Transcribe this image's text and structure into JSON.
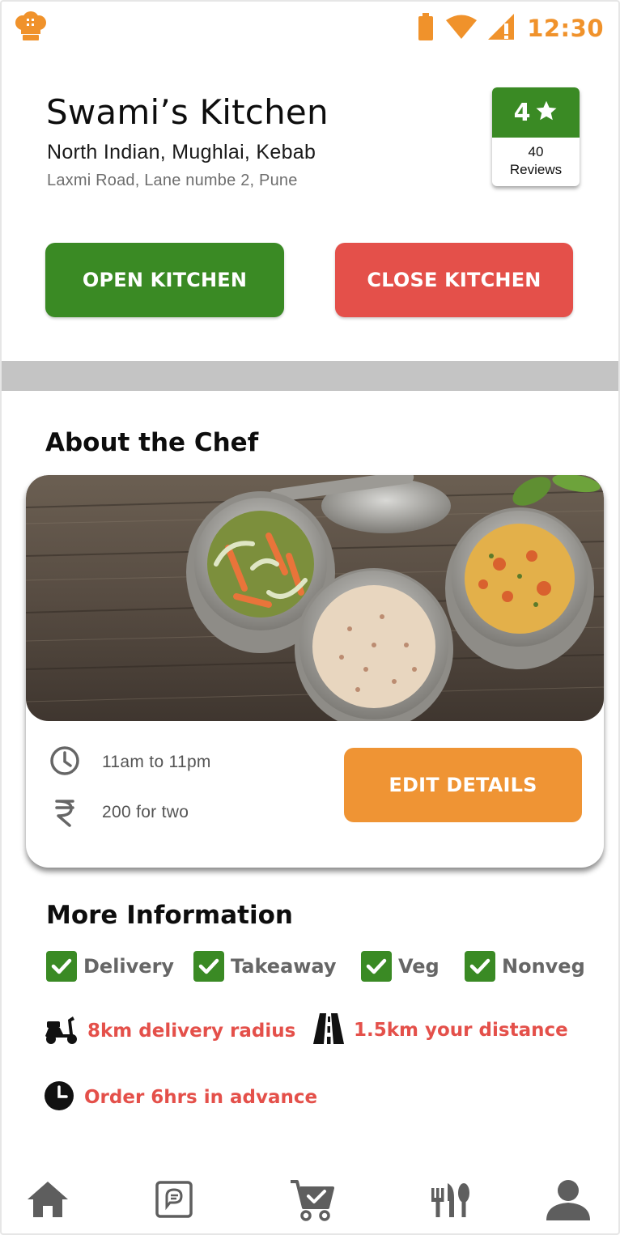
{
  "status_bar": {
    "time": "12:30",
    "accent_color": "#f0922b",
    "icons": [
      "chef-hat-logo-icon",
      "battery-icon",
      "wifi-icon",
      "signal-icon"
    ]
  },
  "kitchen": {
    "name": "Swami’s Kitchen",
    "cuisine": "North Indian, Mughlai, Kebab",
    "address": "Laxmi Road, Lane numbe 2, Pune"
  },
  "rating": {
    "value": "4",
    "count": "40",
    "label": "Reviews",
    "color": "#3a8a24"
  },
  "actions": {
    "open_label": "OPEN KITCHEN",
    "close_label": "CLOSE KITCHEN",
    "open_color": "#3a8a24",
    "close_color": "#e4504a"
  },
  "about": {
    "title": "About the Chef",
    "hours": "11am to 11pm",
    "price": "200 for two",
    "edit_label": "EDIT DETAILS",
    "edit_color": "#ef9434"
  },
  "more_info": {
    "title": "More Information",
    "options": [
      {
        "label": "Delivery",
        "checked": true
      },
      {
        "label": "Takeaway",
        "checked": true
      },
      {
        "label": "Veg",
        "checked": true
      },
      {
        "label": "Nonveg",
        "checked": true
      }
    ],
    "delivery_radius": "8km delivery radius",
    "your_distance": "1.5km your distance",
    "advance_order": "Order 6hrs in advance",
    "highlight_color": "#e4504a"
  },
  "bottom_nav": {
    "items": [
      "home-icon",
      "chat-icon",
      "cart-icon",
      "cutlery-icon",
      "profile-icon"
    ]
  }
}
